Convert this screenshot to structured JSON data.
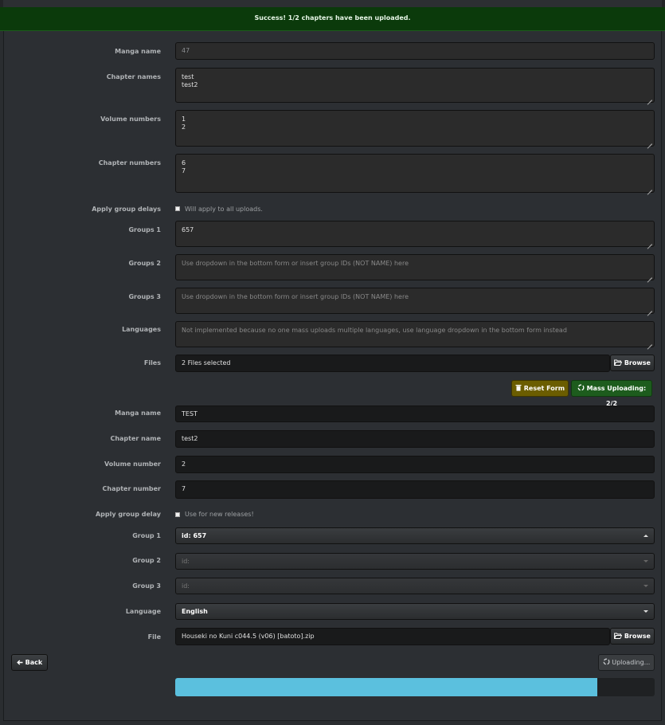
{
  "alert": {
    "text": "Success! 1/2 chapters have been uploaded."
  },
  "mass_form": {
    "manga_name": {
      "label": "Manga name",
      "value": "47"
    },
    "chapter_names": {
      "label": "Chapter names",
      "value": "test\ntest2"
    },
    "volume_numbers": {
      "label": "Volume numbers",
      "value": "1\n2"
    },
    "chapter_numbers": {
      "label": "Chapter numbers",
      "value": "6\n7"
    },
    "apply_group_delays": {
      "label": "Apply group delays",
      "hint": "Will apply to all uploads."
    },
    "groups_1": {
      "label": "Groups 1",
      "value": "657"
    },
    "groups_2": {
      "label": "Groups 2",
      "placeholder": "Use dropdown in the bottom form or insert group IDs (NOT NAME) here"
    },
    "groups_3": {
      "label": "Groups 3",
      "placeholder": "Use dropdown in the bottom form or insert group IDs (NOT NAME) here"
    },
    "languages": {
      "label": "Languages",
      "placeholder": "Not implemented because no one mass uploads multiple languages, use language dropdown in the bottom form instead"
    },
    "files": {
      "label": "Files",
      "value": "2 Files selected",
      "browse_label": "Browse"
    },
    "reset_label": "Reset Form",
    "mass_label": "Mass Uploading: 2/2"
  },
  "single_form": {
    "manga_name": {
      "label": "Manga name",
      "value": "TEST"
    },
    "chapter_name": {
      "label": "Chapter name",
      "value": "test2"
    },
    "volume_number": {
      "label": "Volume number",
      "value": "2"
    },
    "chapter_number": {
      "label": "Chapter number",
      "value": "7"
    },
    "apply_group_delay": {
      "label": "Apply group delay",
      "hint": "Use for new releases!"
    },
    "group_1": {
      "label": "Group 1",
      "value": "id: 657"
    },
    "group_2": {
      "label": "Group 2",
      "value": "id:"
    },
    "group_3": {
      "label": "Group 3",
      "value": "id:"
    },
    "language": {
      "label": "Language",
      "value": "English"
    },
    "file": {
      "label": "File",
      "value": "Houseki no Kuni c044.5 (v06) [batoto].zip",
      "browse_label": "Browse"
    },
    "back_label": "Back",
    "uploading_label": "Uploading...",
    "progress": 0.88
  },
  "colors": {
    "success_bg": "#0b3a0b",
    "progress": "#5bc0de",
    "reset": "#6b5d00",
    "mass": "#1d5c1d"
  }
}
